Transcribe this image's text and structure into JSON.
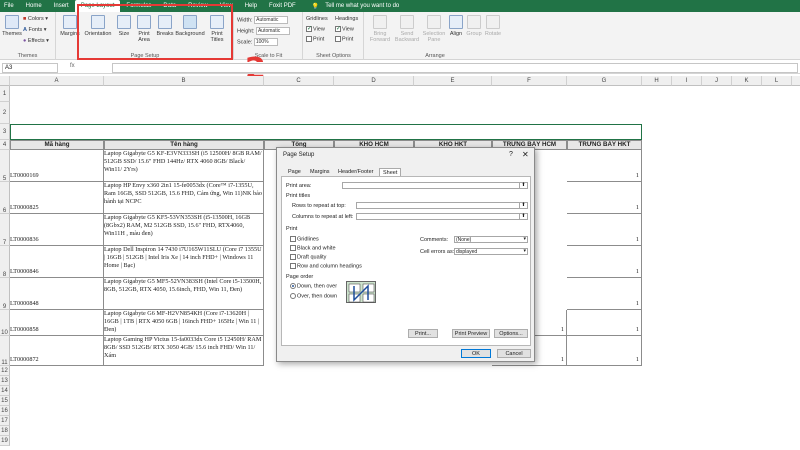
{
  "tabs": [
    "File",
    "Home",
    "Insert",
    "Page Layout",
    "Formulas",
    "Data",
    "Review",
    "View",
    "Help",
    "Foxit PDF"
  ],
  "active_tab": "Page Layout",
  "tell_me": "Tell me what you want to do",
  "ribbon": {
    "themes": {
      "themes": "Themes",
      "colors": "Colors",
      "fonts": "Fonts",
      "effects": "Effects",
      "label": "Themes"
    },
    "page_setup": {
      "margins": "Margins",
      "orientation": "Orientation",
      "size": "Size",
      "print_area": "Print Area",
      "breaks": "Breaks",
      "background": "Background",
      "print_titles": "Print Titles",
      "label": "Page Setup"
    },
    "scale_to_fit": {
      "width": "Width:",
      "width_val": "Automatic",
      "height": "Height:",
      "height_val": "Automatic",
      "scale": "Scale:",
      "scale_val": "100%",
      "label": "Scale to Fit"
    },
    "sheet_options": {
      "gridlines": "Gridlines",
      "headings": "Headings",
      "view": "View",
      "print": "Print",
      "label": "Sheet Options"
    },
    "arrange": {
      "bring": "Bring Forward",
      "send": "Send Backward",
      "selection": "Selection Pane",
      "align": "Align",
      "group": "Group",
      "rotate": "Rotate",
      "label": "Arrange"
    }
  },
  "annotation_number": "2",
  "formula_bar": {
    "name_box": "A3",
    "fx": "fx"
  },
  "columns": [
    "A",
    "B",
    "C",
    "D",
    "E",
    "F",
    "G",
    "H",
    "I",
    "J",
    "K",
    "L",
    "M"
  ],
  "header_row": [
    "Mã hàng",
    "Tên hàng",
    "Tổng",
    "KHO HCM",
    "KHO HKT",
    "TRƯNG BÀY HCM",
    "TRƯNG BÀY HKT"
  ],
  "rows": [
    {
      "n": "5",
      "code": "LT0000169",
      "name": "Laptop Gigabyte G5 KF-E3VN333SH (i5 12500H/ 8GB RAM/ 512GB SSD/ 15.6\" FHD 144Hz/ RTX 4060 8GB/ Black/ Win11/ 2Yrs)",
      "f": "",
      "g": "1"
    },
    {
      "n": "6",
      "code": "LT0000825",
      "name": "Laptop HP Envy x360 2in1 15-fe0053dx (Core™ i7-1355U, Ram 16GB, SSD 512GB, 15.6 FHD, Cảm ứng, Win 11)NK bảo hành tại NCPC",
      "f": "",
      "g": "1"
    },
    {
      "n": "7",
      "code": "LT0000836",
      "name": "Laptop Gigabyte G5 KF5-53VN353SH (i5-13500H, 16GB (8Gbx2) RAM, M2 512GB SSD, 15.6\" FHD, RTX4060, Win11H , màu đen)",
      "f": "",
      "g": "1"
    },
    {
      "n": "8",
      "code": "LT0000846",
      "name": "Laptop Dell Inspiron 14 7430 i7U165W11SLU (Core i7 1355U | 16GB | 512GB | Intel Iris Xe | 14 inch FHD+ | Windows 11 Home | Bạc)",
      "f": "",
      "g": "1"
    },
    {
      "n": "9",
      "code": "LT0000848",
      "name": "Laptop Gigabyte G5 MF5-52VN383SH (Intel Core i5-13500H, 8GB, 512GB, RTX 4050, 15.6inch, FHD, Win 11, Đen)",
      "f": "",
      "g": "1"
    },
    {
      "n": "10",
      "code": "LT0000858",
      "name": "Laptop Gigabyte G6 MF-H2VN854KH (Core i7-13620H | 16GB | 1TB | RTX 4050 6GB | 16inch FHD+ 165Hz | Win 11 | Đen)",
      "f": "1",
      "g": "1"
    },
    {
      "n": "11",
      "code": "LT0000872",
      "name": "Laptop Gaming HP Victus 15-fa0033dx Core i5 12450H/ RAM 8GB/ SSD 512GB/ RTX 3050 4GB/ 15.6 inch FHD/ Win 11/ Xám",
      "f": "1",
      "g": "1"
    }
  ],
  "dialog": {
    "title": "Page Setup",
    "help": "?",
    "close": "✕",
    "tabs": [
      "Page",
      "Margins",
      "Header/Footer",
      "Sheet"
    ],
    "print_area": "Print area:",
    "print_titles": "Print titles",
    "rows_repeat": "Rows to repeat at top:",
    "cols_repeat": "Columns to repeat at left:",
    "print": "Print",
    "gridlines": "Gridlines",
    "bw": "Black and white",
    "draft": "Draft quality",
    "rowcol": "Row and column headings",
    "comments": "Comments:",
    "comments_val": "(None)",
    "errors": "Cell errors as:",
    "errors_val": "displayed",
    "page_order": "Page order",
    "down_over": "Down, then over",
    "over_down": "Over, then down",
    "btn_print": "Print...",
    "btn_preview": "Print Preview",
    "btn_options": "Options...",
    "ok": "OK",
    "cancel": "Cancel",
    "collapse": "⬆"
  }
}
